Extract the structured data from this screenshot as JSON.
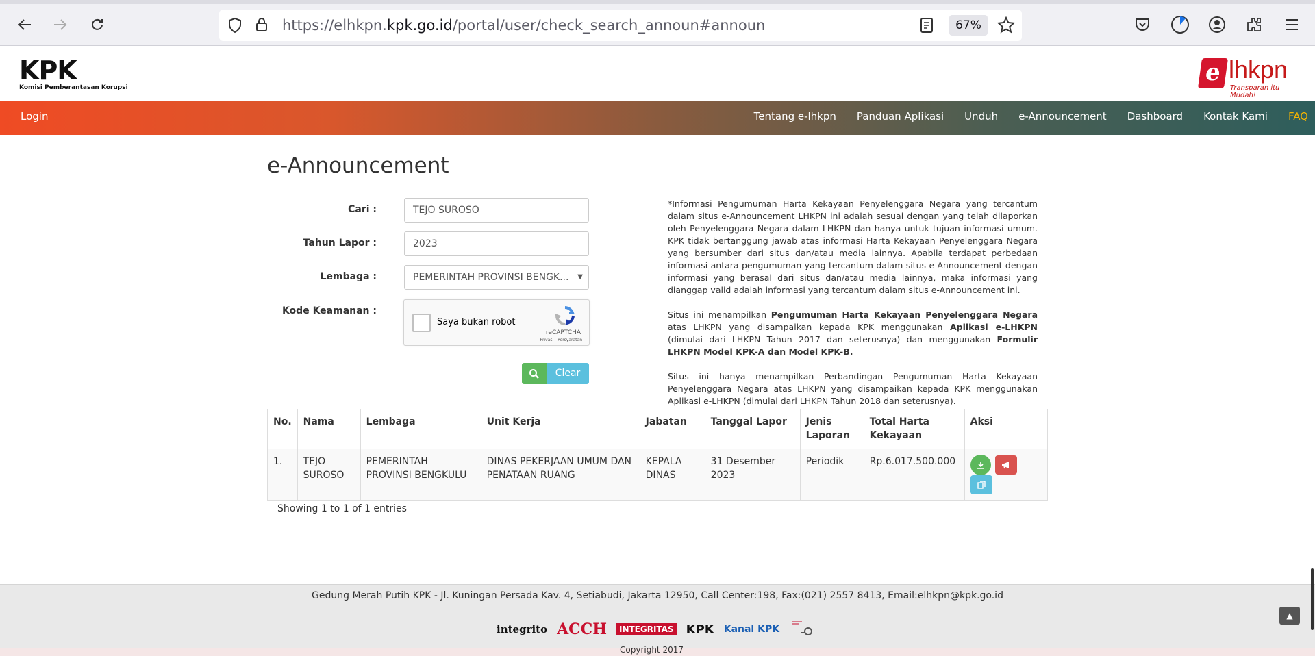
{
  "browser": {
    "url_prefix": "https://elhkpn.",
    "url_domain": "kpk.go.id",
    "url_suffix": "/portal/user/check_search_announ#announ",
    "zoom": "67%"
  },
  "header": {
    "kpk_logo_text": "KPK",
    "kpk_logo_subtitle": "Komisi Pemberantasan Korupsi",
    "elhkpn_e": "e",
    "elhkpn_rest": "lhkpn",
    "elhkpn_tagline": "Transparan itu Mudah!"
  },
  "nav": {
    "login": "Login",
    "items": [
      "Tentang e-lhkpn",
      "Panduan Aplikasi",
      "Unduh",
      "e-Announcement",
      "Dashboard",
      "Kontak Kami",
      "FAQ"
    ]
  },
  "page": {
    "title": "e-Announcement"
  },
  "form": {
    "cari_label": "Cari :",
    "cari_value": "TEJO SUROSO",
    "tahun_label": "Tahun Lapor :",
    "tahun_value": "2023",
    "lembaga_label": "Lembaga :",
    "lembaga_value": "PEMERINTAH PROVINSI BENGK...",
    "kode_label": "Kode Keamanan :",
    "captcha_label": "Saya bukan robot",
    "captcha_brand": "reCAPTCHA",
    "captcha_links": "Privasi - Persyaratan",
    "clear_label": "Clear"
  },
  "info": {
    "p1": "*Informasi Pengumuman Harta Kekayaan Penyelenggara Negara yang tercantum dalam situs e-Announcement LHKPN ini adalah sesuai dengan yang telah dilaporkan oleh Penyelenggara Negara dalam LHKPN dan hanya untuk tujuan informasi umum. KPK tidak bertanggung jawab atas informasi Harta Kekayaan Penyelenggara Negara yang bersumber dari situs dan/atau media lainnya. Apabila terdapat perbedaan informasi antara pengumuman yang tercantum dalam situs e-Announcement dengan informasi yang berasal dari situs dan/atau media lainnya, maka informasi yang dianggap valid adalah informasi yang tercantum dalam situs e-Announcement ini.",
    "p2_a": "Situs ini menampilkan ",
    "p2_b": "Pengumuman Harta Kekayaan Penyelenggara Negara",
    "p2_c": " atas LHKPN yang disampaikan kepada KPK menggunakan ",
    "p2_d": "Aplikasi e-LHKPN",
    "p2_e": " (dimulai dari LHKPN Tahun 2017 dan seterusnya) dan menggunakan ",
    "p2_f": "Formulir LHKPN Model KPK-A dan Model KPK-B.",
    "p3": "Situs ini hanya menampilkan Perbandingan Pengumuman Harta Kekayaan Penyelenggara Negara atas LHKPN yang disampaikan kepada KPK menggunakan Aplikasi e-LHKPN (dimulai dari LHKPN Tahun 2018 dan seterusnya)."
  },
  "table": {
    "headers": [
      "No.",
      "Nama",
      "Lembaga",
      "Unit Kerja",
      "Jabatan",
      "Tanggal Lapor",
      "Jenis Laporan",
      "Total Harta Kekayaan",
      "Aksi"
    ],
    "rows": [
      [
        "1.",
        "TEJO SUROSO",
        "PEMERINTAH PROVINSI BENGKULU",
        "DINAS PEKERJAAN UMUM DAN PENATAAN RUANG",
        "KEPALA DINAS",
        "31 Desember 2023",
        "Periodik",
        "Rp.6.017.500.000"
      ]
    ],
    "showing": "Showing 1 to 1 of 1 entries"
  },
  "footer": {
    "address": "Gedung Merah Putih KPK - Jl. Kuningan Persada Kav. 4, Setiabudi, Jakarta 12950, Call Center:198, Fax:(021) 2557 8413, Email:elhkpn@kpk.go.id",
    "logo1": "integrito",
    "logo2": "ACCH",
    "logo3": "INTEGRITAS",
    "logo4": "KPK",
    "logo5": "Kanal KPK",
    "bottom_text": "Copyright 2017"
  },
  "colors": {
    "nav_start": "#ef4b24",
    "nav_end": "#2e5e5c",
    "faq": "#f7b500",
    "green": "#5cb85c",
    "red": "#d9534f",
    "blue": "#5bc0de"
  }
}
